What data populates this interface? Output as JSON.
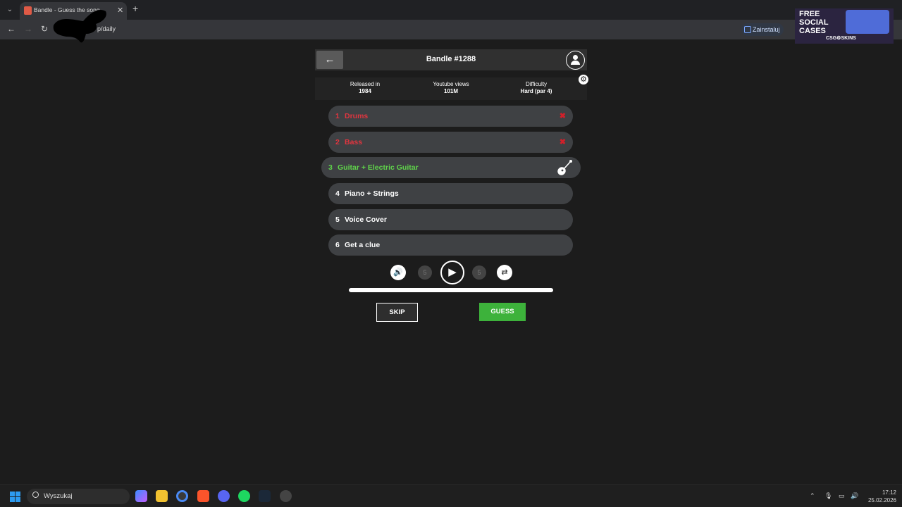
{
  "browser": {
    "tab_title": "Bandle - Guess the song",
    "url": "p/daily",
    "install_label": "Zainstaluj"
  },
  "ad": {
    "headline": "FREE SOCIAL CASES",
    "brand": "CSG⚙SKINS"
  },
  "game": {
    "title": "Bandle #1288",
    "info": [
      {
        "label": "Released in",
        "value": "1984"
      },
      {
        "label": "Youtube views",
        "value": "101M"
      },
      {
        "label": "Difficulty",
        "value": "Hard (par 4)"
      }
    ],
    "stems": [
      {
        "num": "1",
        "label": "Drums",
        "state": "wrong"
      },
      {
        "num": "2",
        "label": "Bass",
        "state": "wrong"
      },
      {
        "num": "3",
        "label": "Guitar + Electric Guitar",
        "state": "current"
      },
      {
        "num": "4",
        "label": "Piano + Strings",
        "state": "pending"
      },
      {
        "num": "5",
        "label": "Voice Cover",
        "state": "pending"
      },
      {
        "num": "6",
        "label": "Get a clue",
        "state": "pending"
      }
    ],
    "rewind_label": "5",
    "forward_label": "5",
    "skip_label": "SKIP",
    "guess_label": "GUESS"
  },
  "taskbar": {
    "search_placeholder": "Wyszukaj",
    "time": "17:12",
    "date": "25.02.2026"
  },
  "colors": {
    "wrong": "#e0353f",
    "current": "#5fd34a",
    "guess": "#3db23b"
  }
}
